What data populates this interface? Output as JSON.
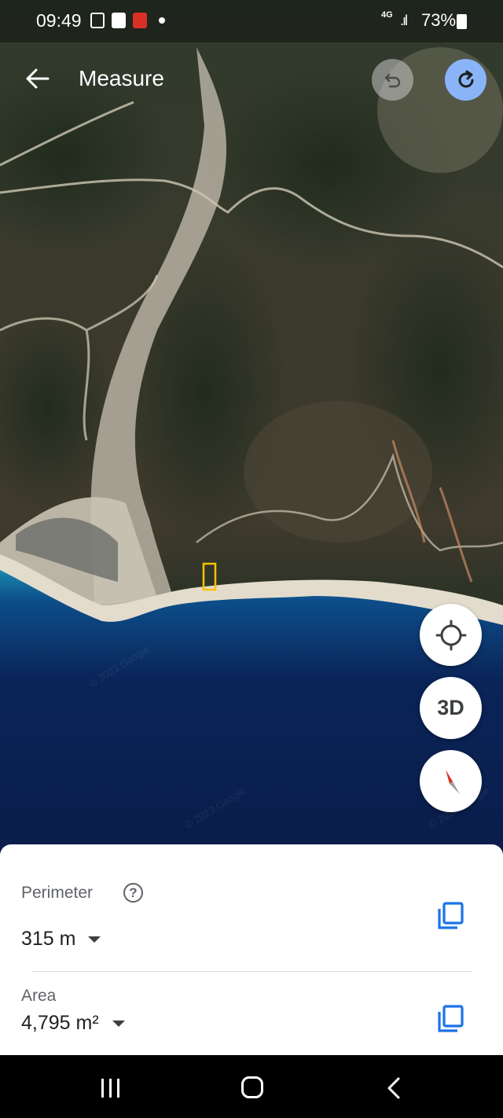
{
  "status_bar": {
    "time": "09:49",
    "network": "4G",
    "battery": "73%"
  },
  "app_bar": {
    "title": "Measure",
    "back_icon": "arrow-left-icon",
    "undo_icon": "undo-icon",
    "redo_icon": "redo-icon"
  },
  "map": {
    "view": "satellite",
    "watermarks": [
      "© 2023 Google",
      "© 2023 Google",
      "© 2023 Google"
    ]
  },
  "map_controls": {
    "location_icon": "my-location-icon",
    "three_d_label": "3D",
    "compass_icon": "compass-icon"
  },
  "measure": {
    "perimeter_label": "Perimeter",
    "perimeter_value": "315 m",
    "area_label": "Area",
    "area_value": "4,795 m²",
    "help_icon": "help-circle-icon",
    "copy_icon": "copy-icon"
  },
  "colors": {
    "accent_blue": "#1a73e8",
    "redo_button": "#8ab4f8",
    "measure_outline": "#f9c300"
  }
}
